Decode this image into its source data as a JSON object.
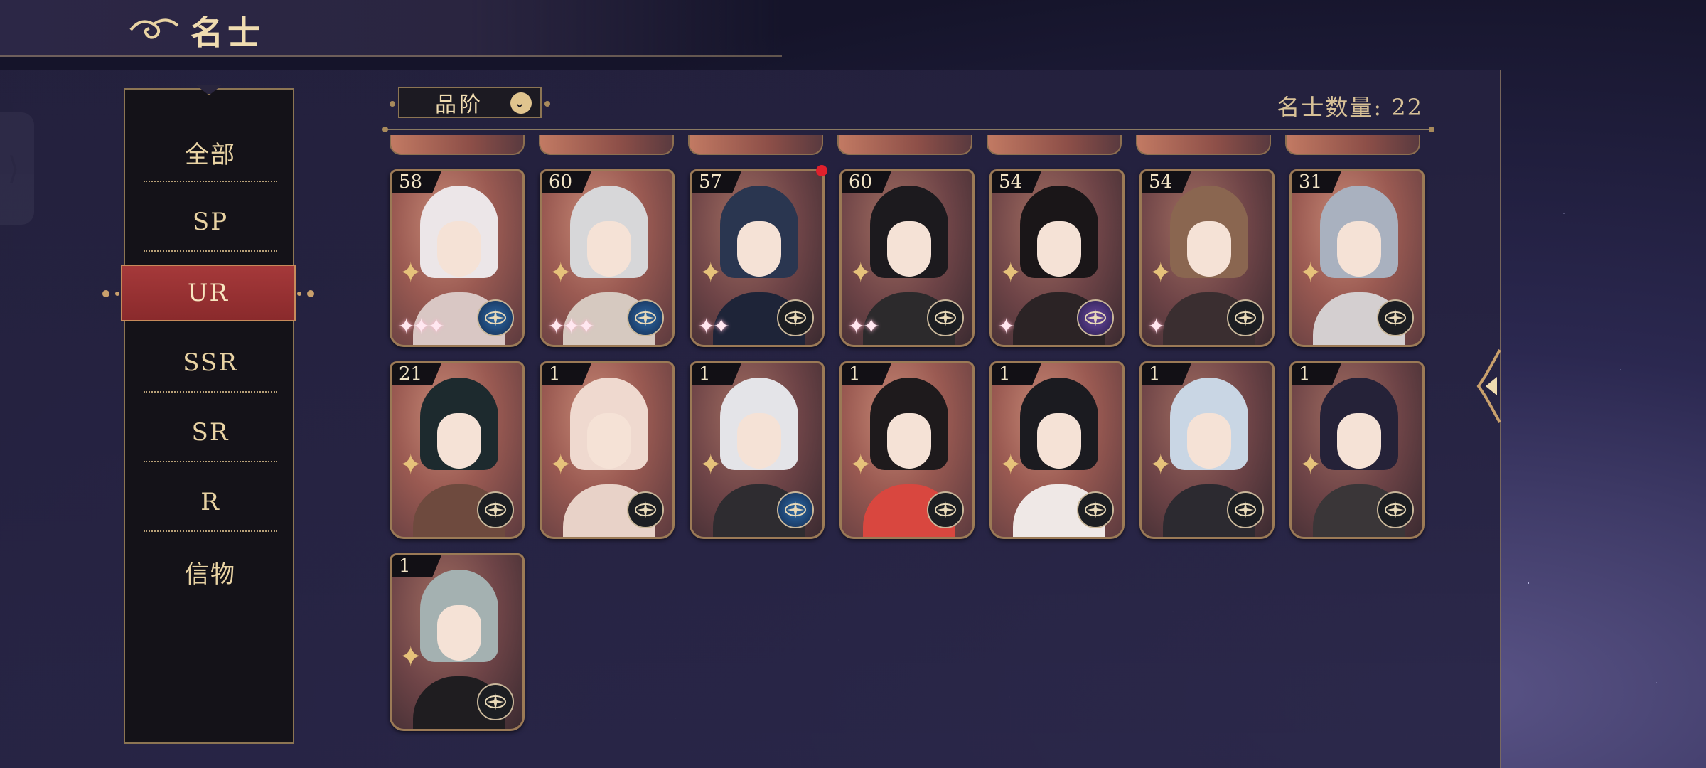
{
  "header": {
    "title": "名士"
  },
  "sidebar": {
    "items": [
      {
        "label": "全部",
        "active": false
      },
      {
        "label": "SP",
        "active": false
      },
      {
        "label": "UR",
        "active": true
      },
      {
        "label": "SSR",
        "active": false
      },
      {
        "label": "SR",
        "active": false
      },
      {
        "label": "R",
        "active": false
      },
      {
        "label": "信物",
        "active": false
      }
    ]
  },
  "filter": {
    "label": "品阶"
  },
  "count": {
    "label": "名士数量: 22"
  },
  "colors": {
    "accent_gold": "#e7d3a6",
    "active_red": "#9a3132",
    "notification": "#e0202c"
  },
  "cards": [
    {
      "level": "58",
      "hair": "#ece6e8",
      "body": "#d9c7c4",
      "badge": "blue",
      "stars": 3,
      "notify": false
    },
    {
      "level": "60",
      "hair": "#d7d7d9",
      "body": "#d6c9c0",
      "badge": "blue",
      "stars": 3,
      "notify": false
    },
    {
      "level": "57",
      "hair": "#2a3650",
      "body": "#1e2438",
      "badge": "dark",
      "stars": 2,
      "notify": true
    },
    {
      "level": "60",
      "hair": "#1c1a1e",
      "body": "#2c2a2c",
      "badge": "dark",
      "stars": 2,
      "notify": false
    },
    {
      "level": "54",
      "hair": "#1a1618",
      "body": "#2b2325",
      "badge": "purple",
      "stars": 1,
      "notify": false
    },
    {
      "level": "54",
      "hair": "#8a6650",
      "body": "#3a2e30",
      "badge": "dark",
      "stars": 1,
      "notify": false
    },
    {
      "level": "31",
      "hair": "#a9b1bf",
      "body": "#d4cfd0",
      "badge": "dark",
      "stars": 0,
      "notify": false
    },
    {
      "level": "21",
      "hair": "#1d2a2e",
      "body": "#6e4a3e",
      "badge": "dark",
      "stars": 0,
      "notify": false
    },
    {
      "level": "1",
      "hair": "#efd9cf",
      "body": "#e8d2c8",
      "badge": "dark",
      "stars": 0,
      "notify": false
    },
    {
      "level": "1",
      "hair": "#e4e4e8",
      "body": "#2e2c30",
      "badge": "blue",
      "stars": 0,
      "notify": false
    },
    {
      "level": "1",
      "hair": "#1e1a1c",
      "body": "#d9473f",
      "badge": "dark",
      "stars": 0,
      "notify": false
    },
    {
      "level": "1",
      "hair": "#1b1b20",
      "body": "#efe8e6",
      "badge": "dark",
      "stars": 0,
      "notify": false
    },
    {
      "level": "1",
      "hair": "#c9d6e4",
      "body": "#2c2a30",
      "badge": "dark",
      "stars": 0,
      "notify": false
    },
    {
      "level": "1",
      "hair": "#252238",
      "body": "#3a3638",
      "badge": "dark",
      "stars": 0,
      "notify": false
    },
    {
      "level": "1",
      "hair": "#a4b1b1",
      "body": "#1f1d20",
      "badge": "dark",
      "stars": 0,
      "notify": false
    }
  ]
}
